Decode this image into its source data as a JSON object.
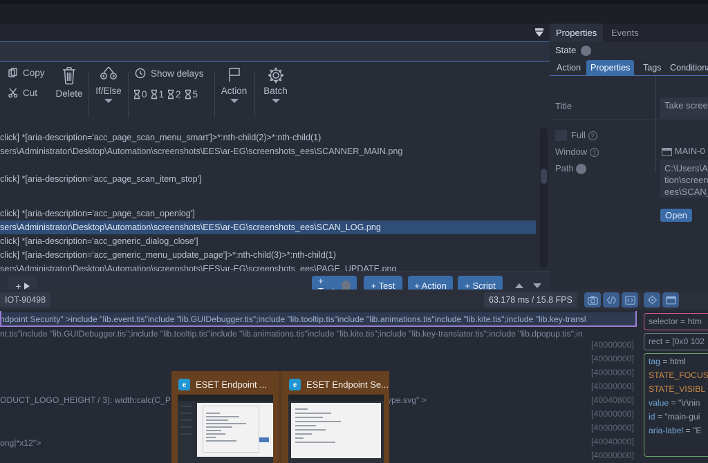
{
  "app": {
    "theme_bg": "#282c37",
    "accent": "#3a6ca8",
    "selection": "#2f4d77"
  },
  "toolbar": {
    "copy_label": "Copy",
    "cut_label": "Cut",
    "delete_label": "Delete",
    "ifelse_label": "If/Else",
    "show_delays_label": "Show delays",
    "delay_values": [
      "0",
      "1",
      "2",
      "5"
    ],
    "action_label": "Action",
    "batch_label": "Batch",
    "filter_icon": "filter-funnel-icon",
    "copy_icon": "copy-icon",
    "cut_icon": "scissors-icon",
    "delete_icon": "trash-icon",
    "ifelse_icon": "branch-icon",
    "clock_icon": "clock-icon",
    "hourglass_icon": "hourglass-icon",
    "action_icon": "flag-icon",
    "batch_icon": "gear-icon"
  },
  "steps": [
    {
      "text": "click]  *[aria-description='acc_page_scan_menu_smart']>*:nth-child(2)>*:nth-child(1)",
      "type": "step",
      "selected": false
    },
    {
      "text": "sers\\Administrator\\Desktop\\Automation\\screenshots\\EES\\ar-EG\\screenshots_ees\\SCANNER_MAIN.png",
      "type": "path",
      "selected": false
    },
    {
      "text": "",
      "type": "blank",
      "selected": false
    },
    {
      "text": "click]  *[aria-description='acc_page_scan_item_stop']",
      "type": "step",
      "selected": false
    },
    {
      "text": "",
      "type": "blank",
      "selected": false
    },
    {
      "text": "",
      "type": "blank",
      "selected": false
    },
    {
      "text": "click]  *[aria-description='acc_page_scan_openlog']",
      "type": "step",
      "selected": false
    },
    {
      "text": "sers\\Administrator\\Desktop\\Automation\\screenshots\\EES\\ar-EG\\screenshots_ees\\SCAN_LOG.png",
      "type": "path",
      "selected": true
    },
    {
      "text": "click]  *[aria-description='acc_generic_dialog_close']",
      "type": "step",
      "selected": false
    },
    {
      "text": "click]  *[aria-description='acc_generic_menu_update_page']>*:nth-child(3)>*:nth-child(1)",
      "type": "step",
      "selected": false
    },
    {
      "text": "sers\\Administrator\\Desktop\\Automation\\screenshots\\EES\\ar-EG\\screenshots_ees\\PAGE_UPDATE.png",
      "type": "path",
      "selected": false
    }
  ],
  "action_bar": {
    "add_run_label": "+",
    "play_icon": "play-icon",
    "buttons": [
      {
        "label": "+ Test",
        "icon": "stack-icon"
      },
      {
        "label": "+ Test",
        "icon": ""
      },
      {
        "label": "+ Action",
        "icon": ""
      },
      {
        "label": "+ Script",
        "icon": ""
      }
    ],
    "move_up_icon": "triangle-up-icon",
    "move_down_icon": "triangle-down-icon"
  },
  "properties_panel": {
    "tabs": [
      {
        "label": "Properties",
        "active": true
      },
      {
        "label": "Events",
        "active": false
      }
    ],
    "state_label": "State",
    "subtabs": [
      {
        "label": "Action",
        "active": false
      },
      {
        "label": "Properties",
        "active": true
      },
      {
        "label": "Tags",
        "active": false
      },
      {
        "label": "Conditiona",
        "active": false
      }
    ],
    "fields": {
      "title_label": "Title",
      "title_value": "Take screen",
      "full_label": "Full",
      "window_label": "Window",
      "window_value": "MAIN-0",
      "path_label": "Path",
      "path_value": "C:\\Users\\Ad\ntion\\screen\nees\\SCAN_",
      "path_line1": "C:\\Users\\Ad",
      "path_line2": "tion\\screen",
      "path_line3": "ees\\SCAN_",
      "open_label": "Open"
    }
  },
  "status_bar": {
    "session_label": "IOT-90498",
    "fps_label": "63.178 ms / 15.8 FPS",
    "icons": [
      "camera-icon",
      "code-brackets-icon",
      "inspect-panel-icon",
      "crosshair-target-icon",
      "window-icon"
    ]
  },
  "debugger": {
    "code_lines": [
      {
        "text": "ndpoint Security\" >include \"lib.event.tis\"include \"lib.GUIDebugger.tis\";include \"lib.tooltip.tis\"include \"lib.animations.tis\"include \"lib.kite.tis\";include \"lib.key-transl",
        "selected": true
      },
      {
        "text": "nt.tis\"include \"lib.GUIDebugger.tis\";include \"lib.tooltip.tis\"include \"lib.animations.tis\"include \"lib.kite.tis\";include \"lib.key-translator.tis\";include \"lib.dpopup.tis\";in",
        "selected": false
      },
      {
        "text": "",
        "selected": false
      },
      {
        "text": "",
        "selected": false
      },
      {
        "text": "",
        "selected": false
      },
      {
        "text": "ODUCT_LOGO_HEIGHT / 3); width:calc(C_P",
        "selected": false
      },
      {
        "text": "",
        "selected": false
      },
      {
        "text": "ong|*x12\">",
        "selected": false
      },
      {
        "text": "",
        "selected": false
      }
    ],
    "code_right_fragment": "ype.svg\" >",
    "addresses": [
      "[40000000]",
      "[40000000]",
      "[40000000]",
      "[40000000]",
      "[40040800]",
      "[40000000]",
      "[40000000]",
      "[40040000]",
      "[40000000]"
    ]
  },
  "inspector": {
    "selector_line": "selector =  htm",
    "rect_line": "rect = [0x0 102",
    "attributes": [
      {
        "key": "tag",
        "op": " = ",
        "value": "html",
        "key_color": "#6fa8dc",
        "value_color": "#9aa2b1"
      },
      {
        "key": "STATE_FOCUS",
        "op": "",
        "value": "",
        "key_color": "#cc8b48",
        "value_color": "#cc8b48"
      },
      {
        "key": "STATE_VISIBL",
        "op": "",
        "value": "",
        "key_color": "#cc8b48",
        "value_color": "#cc8b48"
      },
      {
        "key": "value",
        "op": " = ",
        "value": "\"\\r\\nin",
        "key_color": "#6fa8dc",
        "value_color": "#9aa2b1"
      },
      {
        "key": "id",
        "op": " = ",
        "value": "\"main-gui",
        "key_color": "#6fa8dc",
        "value_color": "#9aa2b1"
      },
      {
        "key": "aria-label",
        "op": " = ",
        "value": "\"E",
        "key_color": "#6fa8dc",
        "value_color": "#9aa2b1"
      }
    ]
  },
  "taskbar_previews": [
    {
      "title": "ESET Endpoint ...",
      "app_initial": "e"
    },
    {
      "title": "ESET Endpoint Se...",
      "app_initial": "e"
    }
  ]
}
